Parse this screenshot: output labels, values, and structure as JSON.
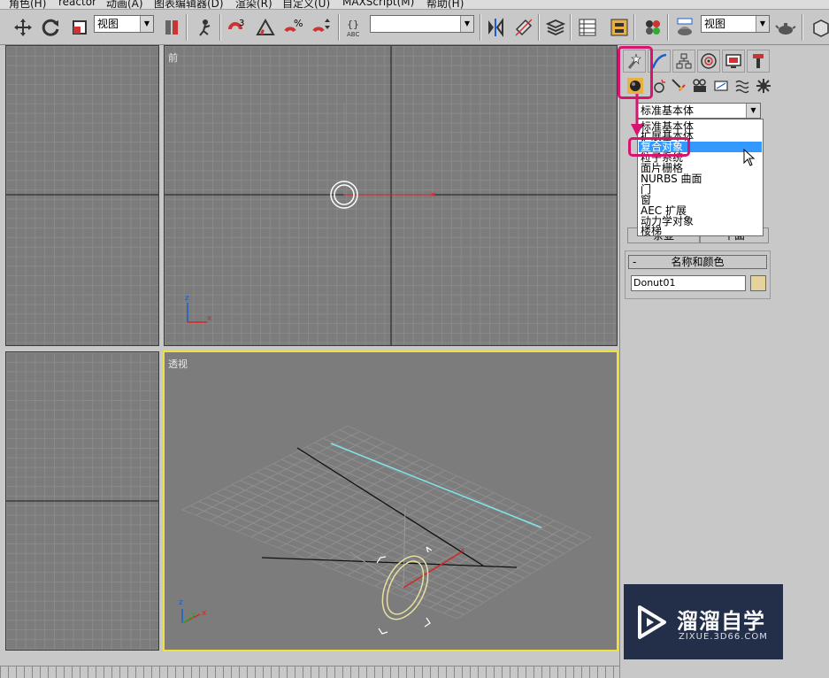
{
  "menubar": {
    "items": [
      "角色(H)",
      "reactor",
      "动画(A)",
      "图表编辑器(D)",
      "渲染(R)",
      "自定义(U)",
      "MAXScript(M)",
      "帮助(H)"
    ]
  },
  "toolbar": {
    "view_combo": "视图",
    "named_selection": "",
    "render_view_combo": "视图"
  },
  "viewports": {
    "front_label": "前",
    "perspective_label": "透视",
    "axis": {
      "x": "x",
      "y": "y",
      "z": "z"
    }
  },
  "command_panel": {
    "category_dropdown": {
      "selected": "标准基本体",
      "options": [
        "标准基本体",
        "扩展基本体",
        "复合对象",
        "粒子系统",
        "面片栅格",
        "NURBS 曲面",
        "门",
        "窗",
        "AEC 扩展",
        "动力学对象",
        "楼梯"
      ],
      "highlighted": "复合对象"
    },
    "hidden_buttons": [
      "茶壶",
      "平面"
    ],
    "name_color_rollout": {
      "title": "名称和颜色",
      "collapse": "-",
      "object_name": "Donut01",
      "color": "#e6d39a"
    }
  },
  "watermark": {
    "title": "溜溜自学",
    "url": "ZIXUE.3D66.COM"
  },
  "colors": {
    "highlight_box": "#d8156e",
    "active_viewport": "#f0e040",
    "selection": "#3399ff"
  }
}
